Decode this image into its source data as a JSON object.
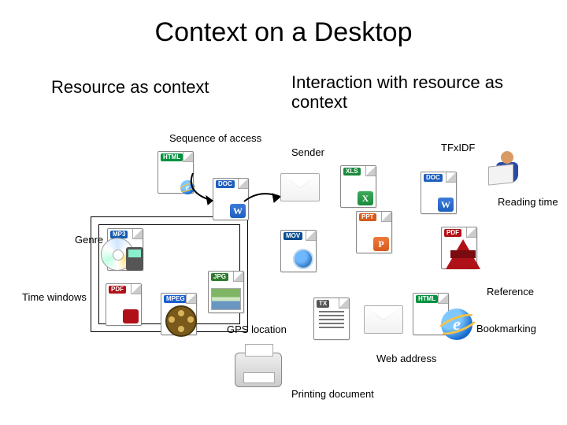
{
  "title": "Context on a Desktop",
  "subheads": {
    "left": "Resource as context",
    "right": "Interaction with resource as context"
  },
  "labels": {
    "sequence_of_access": "Sequence of access",
    "sender": "Sender",
    "tfidf": "TFxIDF",
    "reading_time": "Reading time",
    "genre": "Genre",
    "time_windows": "Time windows",
    "reference": "Reference",
    "gps_location": "GPS location",
    "bookmarking": "Bookmarking",
    "web_address": "Web address",
    "printing_document": "Printing document"
  },
  "icons": {
    "html": "HTML",
    "doc": "DOC",
    "xls": "XLS",
    "ppt": "PPT",
    "pdf": "PDF",
    "mp3": "MP3",
    "mov": "MOV",
    "jpg": "JPG",
    "mpeg": "MPEG",
    "tx": "TX"
  },
  "colors": {
    "html": "#00923f",
    "doc": "#1f5fbf",
    "xls": "#1a8a3c",
    "ppt": "#d65b1e",
    "pdf": "#b01118",
    "mp3": "#155bb0",
    "mov": "#0a4d91",
    "jpg": "#2c7a2c",
    "mpeg": "#1b5fd0",
    "tx": "#555555"
  }
}
